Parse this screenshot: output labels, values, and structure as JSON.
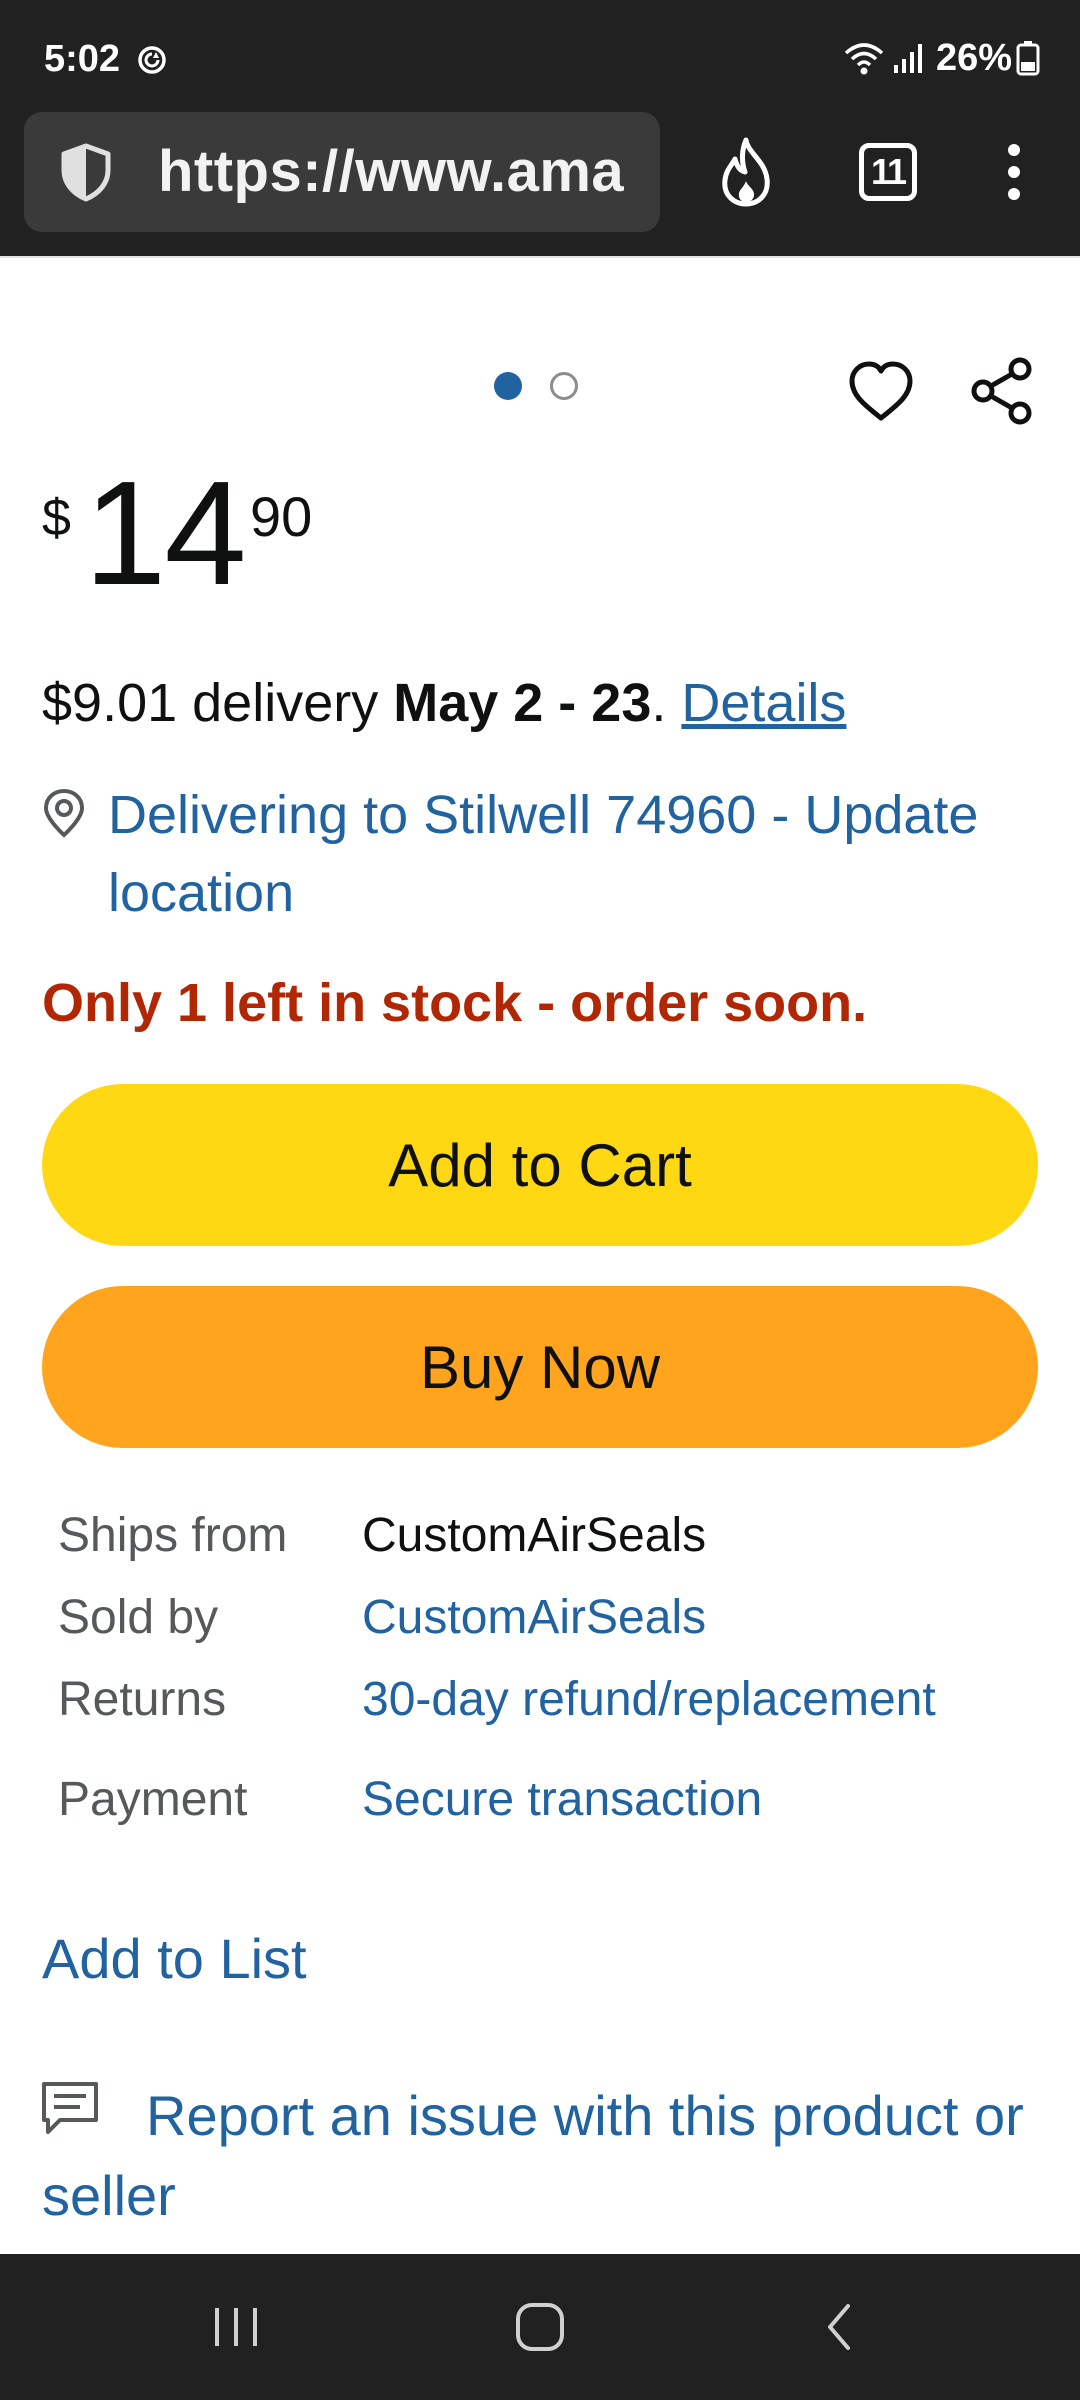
{
  "status_bar": {
    "time": "5:02",
    "battery_percent": "26%"
  },
  "browser": {
    "url": "https://www.ama",
    "tab_count": "11"
  },
  "product": {
    "price": {
      "symbol": "$",
      "whole": "14",
      "fraction": "90"
    },
    "delivery": {
      "fee_text": "$9.01 delivery ",
      "dates": "May 2 - 23",
      "period": ". ",
      "details_link": "Details"
    },
    "location_text": "Delivering to Stilwell 74960 - Update location",
    "stock_text": "Only 1 left in stock - order soon.",
    "add_to_cart_label": "Add to Cart",
    "buy_now_label": "Buy Now",
    "info_rows": [
      {
        "label": "Ships from",
        "value": "CustomAirSeals",
        "is_link": false
      },
      {
        "label": "Sold by",
        "value": "CustomAirSeals",
        "is_link": true
      },
      {
        "label": "Returns",
        "value": "30-day refund/replacement",
        "is_link": true
      },
      {
        "label": "Payment",
        "value": "Secure transaction",
        "is_link": true
      }
    ],
    "add_to_list_label": "Add to List",
    "report_text": "Report an issue with this product or seller"
  },
  "carousel": {
    "active_index": 0,
    "count": 2
  },
  "colors": {
    "link": "#2162a1",
    "stock_alert": "#b12704",
    "add_to_cart_bg": "#ffd814",
    "buy_now_bg": "#ffa41c",
    "system_bar_bg": "#212121"
  },
  "icons": {
    "status": [
      "sync-icon",
      "wifi-icon",
      "signal-icon",
      "battery-icon"
    ],
    "browser": [
      "shield-icon",
      "fire-icon",
      "tabs-icon",
      "more-vert-icon"
    ],
    "page": [
      "heart-icon",
      "share-icon",
      "location-pin-icon",
      "feedback-icon"
    ],
    "nav": [
      "recents-icon",
      "home-icon",
      "back-icon"
    ]
  }
}
